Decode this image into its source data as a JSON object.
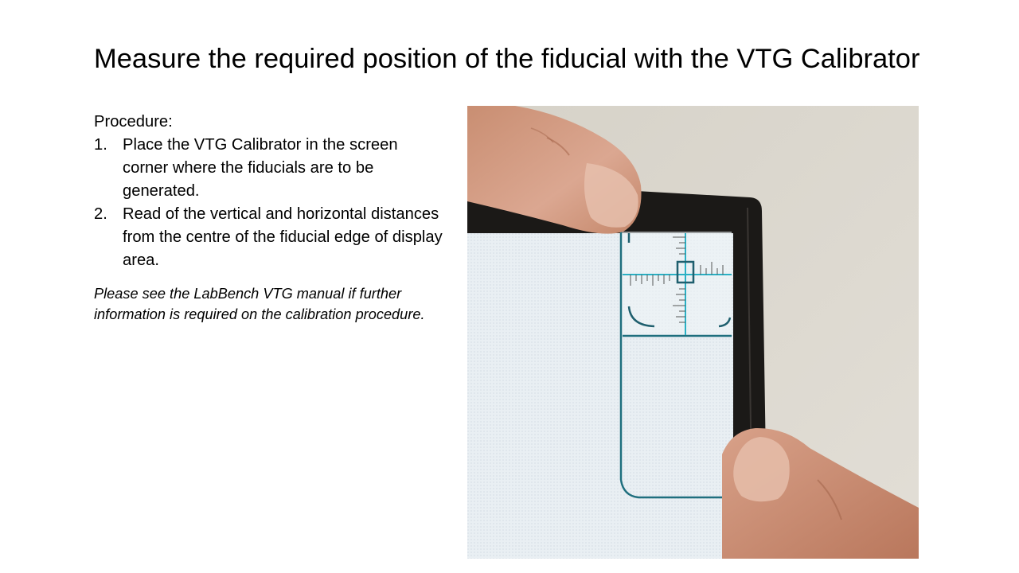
{
  "title": "Measure the required position of the fiducial with the VTG Calibrator",
  "procedure": {
    "heading": "Procedure:",
    "steps": [
      {
        "number": "1.",
        "text": "Place the VTG Calibrator in the screen corner where the fiducials are to be generated."
      },
      {
        "number": "2.",
        "text": "Read of the vertical and horizontal distances from the centre of the fiducial edge of display area."
      }
    ]
  },
  "note": "Please see the LabBench VTG manual if further information is required on the calibration procedure.",
  "colors": {
    "wall": "#dad6cd",
    "bezel": "#1a1816",
    "screen": "#e8eef2",
    "calibrator_line": "#1f8fa0",
    "skin": "#d9a58c"
  }
}
